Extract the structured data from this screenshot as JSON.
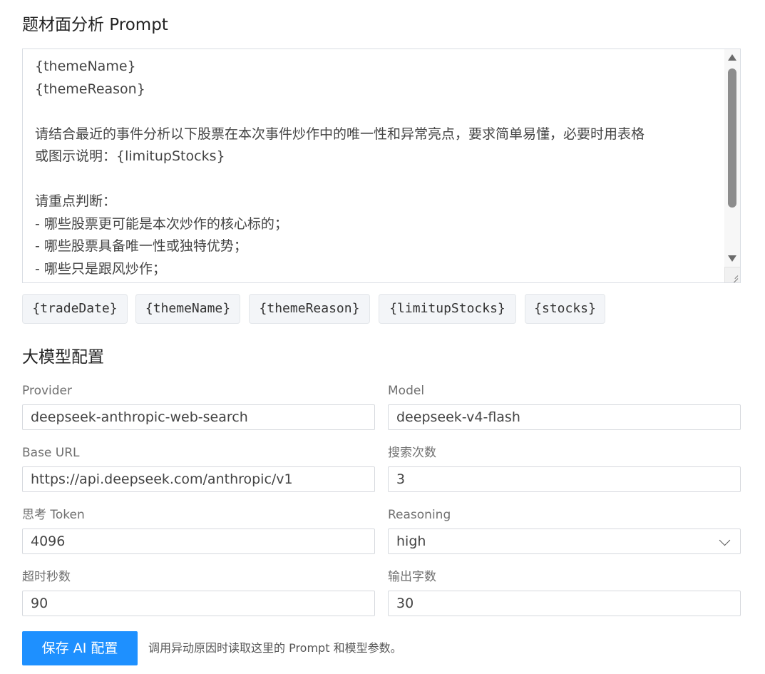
{
  "prompt_section": {
    "title": "题材面分析 Prompt",
    "prompt_lines": [
      "{themeName}",
      "{themeReason}",
      "",
      "请结合最近的事件分析以下股票在本次事件炒作中的唯一性和异常亮点，要求简单易懂，必要时用表格",
      "或图示说明：{limitupStocks}",
      "",
      "请重点判断：",
      "- 哪些股票更可能是本次炒作的核心标的；",
      "- 哪些股票具备唯一性或独特优势；",
      "- 哪些只是跟风炒作；"
    ],
    "variables": [
      "{tradeDate}",
      "{themeName}",
      "{themeReason}",
      "{limitupStocks}",
      "{stocks}"
    ]
  },
  "model_section": {
    "title": "大模型配置",
    "provider": {
      "label": "Provider",
      "value": "deepseek-anthropic-web-search"
    },
    "model": {
      "label": "Model",
      "value": "deepseek-v4-flash"
    },
    "base_url": {
      "label": "Base URL",
      "value": "https://api.deepseek.com/anthropic/v1"
    },
    "search_count": {
      "label": "搜索次数",
      "value": "3"
    },
    "thinking_token": {
      "label": "思考 Token",
      "value": "4096"
    },
    "reasoning": {
      "label": "Reasoning",
      "value": "high"
    },
    "timeout": {
      "label": "超时秒数",
      "value": "90"
    },
    "output_chars": {
      "label": "输出字数",
      "value": "30"
    }
  },
  "footer": {
    "save_label": "保存 AI 配置",
    "hint": "调用异动原因时读取这里的 Prompt 和模型参数。"
  },
  "colors": {
    "primary": "#1e90ff",
    "chip_bg": "#f3f5f8",
    "border": "#d6d9de"
  }
}
